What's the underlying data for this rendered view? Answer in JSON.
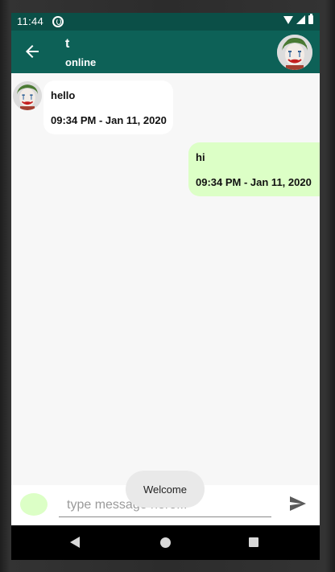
{
  "status_bar": {
    "time": "11:44"
  },
  "app_bar": {
    "contact_name": "t",
    "contact_status": "online"
  },
  "messages": [
    {
      "direction": "incoming",
      "text": "hello",
      "timestamp": "09:34 PM - Jan 11, 2020"
    },
    {
      "direction": "outgoing",
      "text": "hi",
      "timestamp": "09:34 PM - Jan 11, 2020"
    }
  ],
  "composer": {
    "placeholder": "type message here..."
  },
  "toast": {
    "text": "Welcome"
  },
  "colors": {
    "status_bar": "#0b4f47",
    "app_bar": "#0d6157",
    "outgoing_bubble": "#dcffc6",
    "incoming_bubble": "#ffffff",
    "background": "#f7f7f7"
  },
  "icons": {
    "back": "arrow-left-icon",
    "send": "send-icon",
    "avatar": "joker-avatar"
  }
}
